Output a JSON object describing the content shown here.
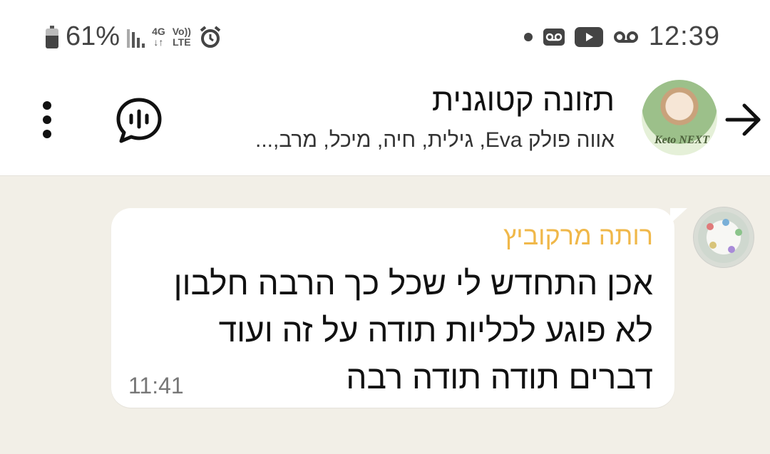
{
  "status_bar": {
    "battery_percent": "61%",
    "battery_level": 0.61,
    "network_type": "4G",
    "volte_top": "Vo))",
    "volte_bottom": "LTE",
    "time": "12:39",
    "left_icons": [
      "battery-icon",
      "signal-icon",
      "network-4g-icon",
      "volte-icon",
      "alarm-icon"
    ],
    "right_icons": [
      "notification-dot-icon",
      "voicemail-icon",
      "youtube-icon",
      "voicemail-icon"
    ]
  },
  "header": {
    "group_name": "תזונה קטוגנית",
    "members": "אווה פולק Eva, גילית, חיה, מיכל, מרב,...",
    "avatar_logo_text": "Keto NEXT",
    "icons": [
      "back-arrow-icon",
      "voice-chat-icon",
      "more-vert-icon"
    ]
  },
  "message": {
    "sender": "רותה מרקוביץ",
    "text_lines": [
      "אכן התחדש לי שכל כך הרבה חלבון",
      "לא פוגע לכליות תודה על זה ועוד",
      "דברים תודה תודה רבה"
    ],
    "time": "11:41"
  },
  "colors": {
    "chat_background": "#f2efe7",
    "sender_name": "#f0b84a",
    "header_background": "#ffffff"
  }
}
